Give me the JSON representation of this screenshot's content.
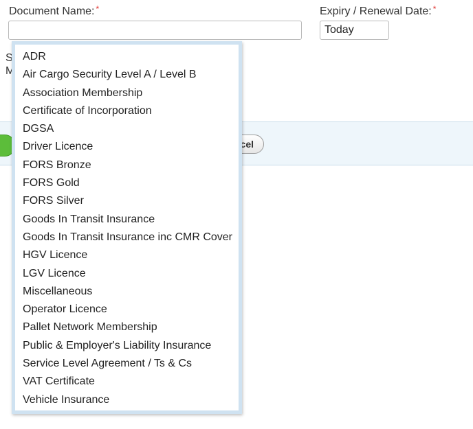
{
  "form": {
    "document_name_label": "Document Name:",
    "required_mark": "*",
    "document_name_value": "",
    "expiry_label": "Expiry / Renewal Date:",
    "expiry_value": "Today"
  },
  "background": {
    "occluded_letter_1": "S",
    "occluded_letter_2": "M",
    "cancel_label_partial": "cel"
  },
  "dropdown": {
    "options": [
      "ADR",
      "Air Cargo Security Level A / Level B",
      "Association Membership",
      "Certificate of Incorporation",
      "DGSA",
      "Driver Licence",
      "FORS Bronze",
      "FORS Gold",
      "FORS Silver",
      "Goods In Transit Insurance",
      "Goods In Transit Insurance inc CMR Cover",
      "HGV Licence",
      "LGV Licence",
      "Miscellaneous",
      "Operator Licence",
      "Pallet Network Membership",
      "Public & Employer's Liability Insurance",
      "Service Level Agreement / Ts & Cs",
      "VAT Certificate",
      "Vehicle Insurance"
    ]
  }
}
